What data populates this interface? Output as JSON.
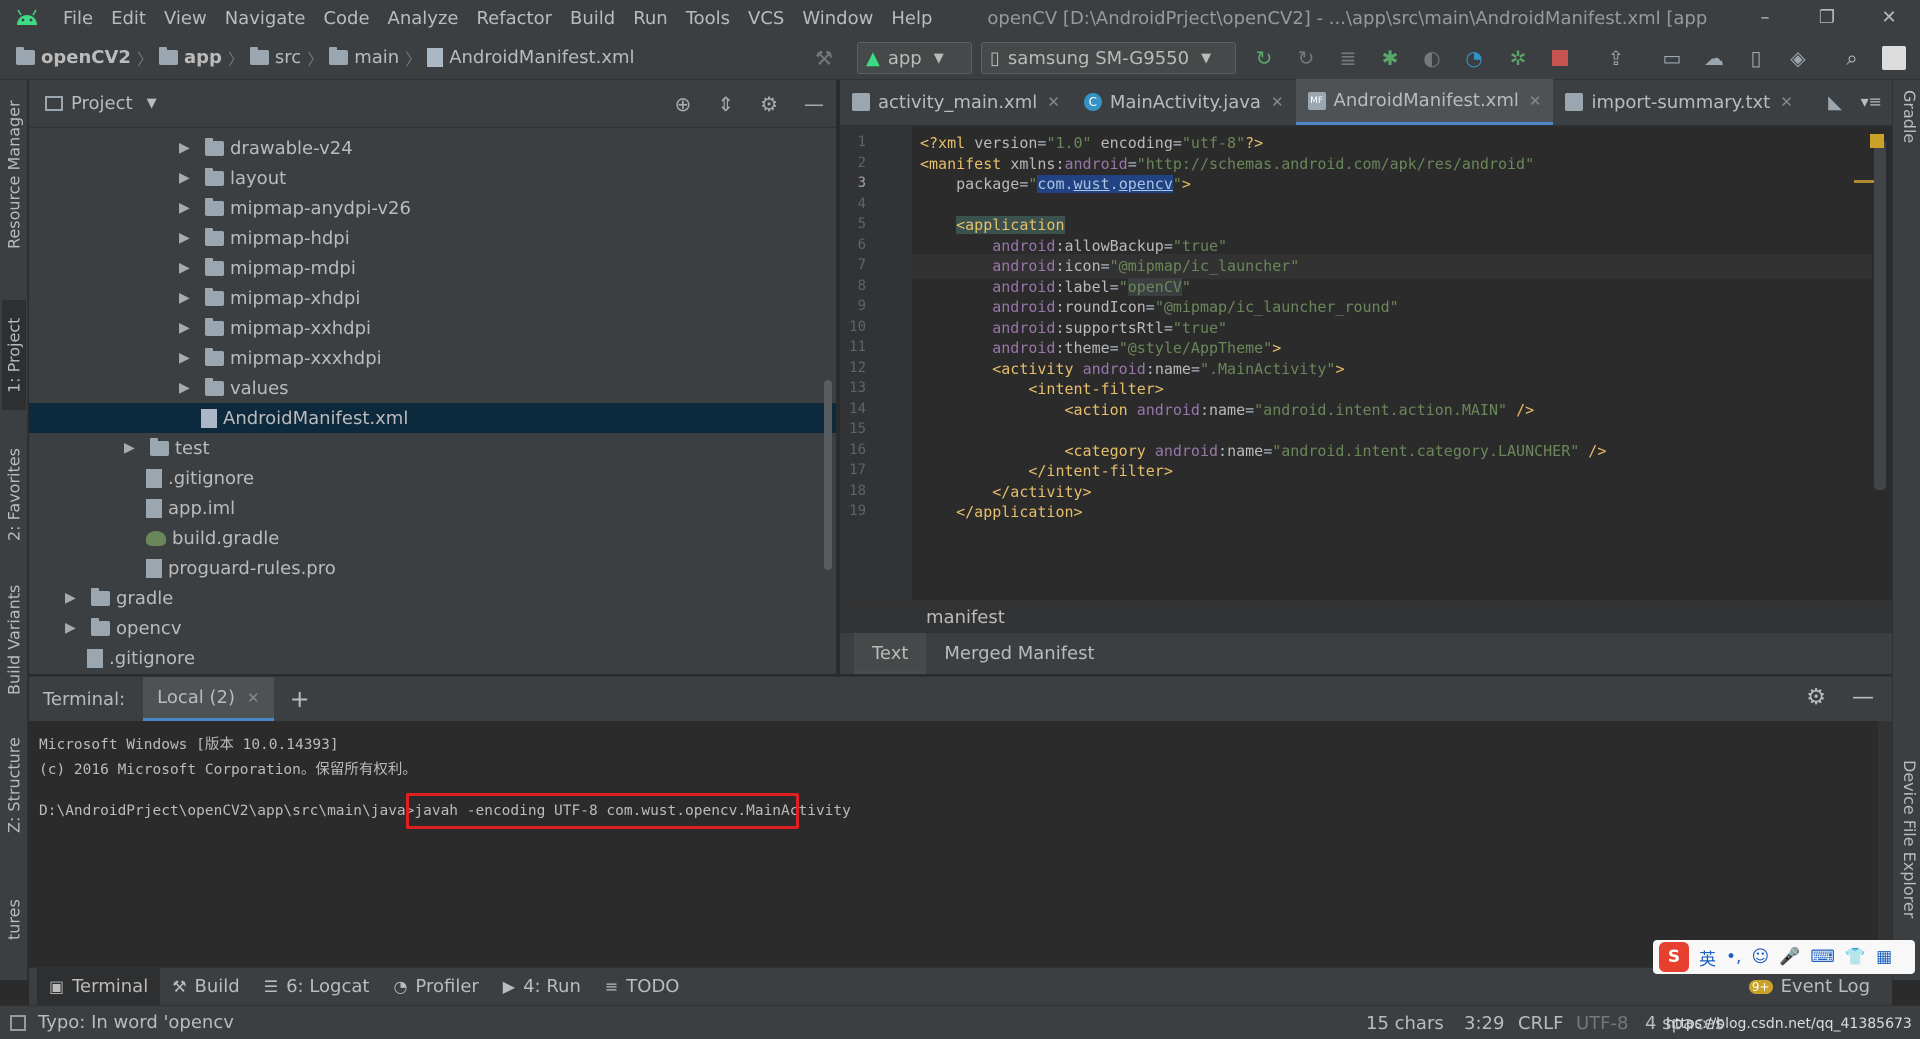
{
  "titlebar": {
    "menu": [
      "File",
      "Edit",
      "View",
      "Navigate",
      "Code",
      "Analyze",
      "Refactor",
      "Build",
      "Run",
      "Tools",
      "VCS",
      "Window",
      "Help"
    ],
    "title": "openCV [D:\\AndroidPrject\\openCV2] - ...\\app\\src\\main\\AndroidManifest.xml [app",
    "controls": [
      "–",
      "❐",
      "✕"
    ]
  },
  "navbar": {
    "breadcrumbs": [
      "openCV2",
      "app",
      "src",
      "main",
      "AndroidManifest.xml"
    ],
    "run_config": "app",
    "device": "samsung SM-G9550"
  },
  "project_panel": {
    "title": "Project",
    "tree": [
      {
        "label": "drawable-v24",
        "type": "folder",
        "expandable": true
      },
      {
        "label": "layout",
        "type": "folder",
        "expandable": true
      },
      {
        "label": "mipmap-anydpi-v26",
        "type": "folder",
        "expandable": true
      },
      {
        "label": "mipmap-hdpi",
        "type": "folder",
        "expandable": true
      },
      {
        "label": "mipmap-mdpi",
        "type": "folder",
        "expandable": true
      },
      {
        "label": "mipmap-xhdpi",
        "type": "folder",
        "expandable": true
      },
      {
        "label": "mipmap-xxhdpi",
        "type": "folder",
        "expandable": true
      },
      {
        "label": "mipmap-xxxhdpi",
        "type": "folder",
        "expandable": true
      },
      {
        "label": "values",
        "type": "folder",
        "expandable": true
      },
      {
        "label": "AndroidManifest.xml",
        "type": "xml",
        "expandable": false,
        "selected": true
      },
      {
        "label": "test",
        "type": "folder",
        "expandable": true
      },
      {
        "label": ".gitignore",
        "type": "file",
        "expandable": false
      },
      {
        "label": "app.iml",
        "type": "file",
        "expandable": false
      },
      {
        "label": "build.gradle",
        "type": "gradle",
        "expandable": false
      },
      {
        "label": "proguard-rules.pro",
        "type": "file",
        "expandable": false
      },
      {
        "label": "gradle",
        "type": "folder",
        "expandable": true
      },
      {
        "label": "opencv",
        "type": "folder",
        "expandable": true
      },
      {
        "label": ".gitignore",
        "type": "file",
        "expandable": false
      }
    ]
  },
  "editor": {
    "tabs": [
      {
        "label": "activity_main.xml",
        "active": false
      },
      {
        "label": "MainActivity.java",
        "active": false
      },
      {
        "label": "AndroidManifest.xml",
        "active": true
      },
      {
        "label": "import-summary.txt",
        "active": false
      }
    ],
    "lines": [
      "1",
      "2",
      "3",
      "4",
      "5",
      "6",
      "7",
      "8",
      "9",
      "10",
      "11",
      "12",
      "13",
      "14",
      "15",
      "16",
      "17",
      "18",
      "19"
    ],
    "breadcrumb": "manifest",
    "bottom_tabs": [
      "Text",
      "Merged Manifest"
    ]
  },
  "terminal": {
    "label": "Terminal:",
    "tab": "Local (2)",
    "lines": [
      "Microsoft Windows [版本 10.0.14393]",
      "(c) 2016 Microsoft Corporation。保留所有权利。",
      "",
      "D:\\AndroidPrject\\openCV2\\app\\src\\main\\java>javah -encoding UTF-8 com.wust.opencv.MainActivity"
    ]
  },
  "tool_windows": [
    {
      "label": "Terminal",
      "icon": "terminal-icon"
    },
    {
      "label": "Build",
      "icon": "hammer-icon"
    },
    {
      "label": "6: Logcat",
      "icon": "logcat-icon"
    },
    {
      "label": "Profiler",
      "icon": "profiler-icon"
    },
    {
      "label": "4: Run",
      "icon": "run-icon"
    },
    {
      "label": "TODO",
      "icon": "todo-icon"
    }
  ],
  "event_log": "Event Log",
  "left_strip": [
    "Resource Manager",
    "1: Project",
    "2: Favorites",
    "Build Variants",
    "Z: Structure",
    "tures"
  ],
  "right_strip": [
    "Gradle",
    "Device File Explorer"
  ],
  "status": {
    "message": "Typo: In word 'opencv",
    "chars": "15 chars",
    "position": "3:29",
    "line_sep": "CRLF",
    "encoding": "UTF-8",
    "indent": "4 spaces",
    "watermark": "https://blog.csdn.net/qq_41385673"
  },
  "ime": {
    "lang": "英"
  }
}
